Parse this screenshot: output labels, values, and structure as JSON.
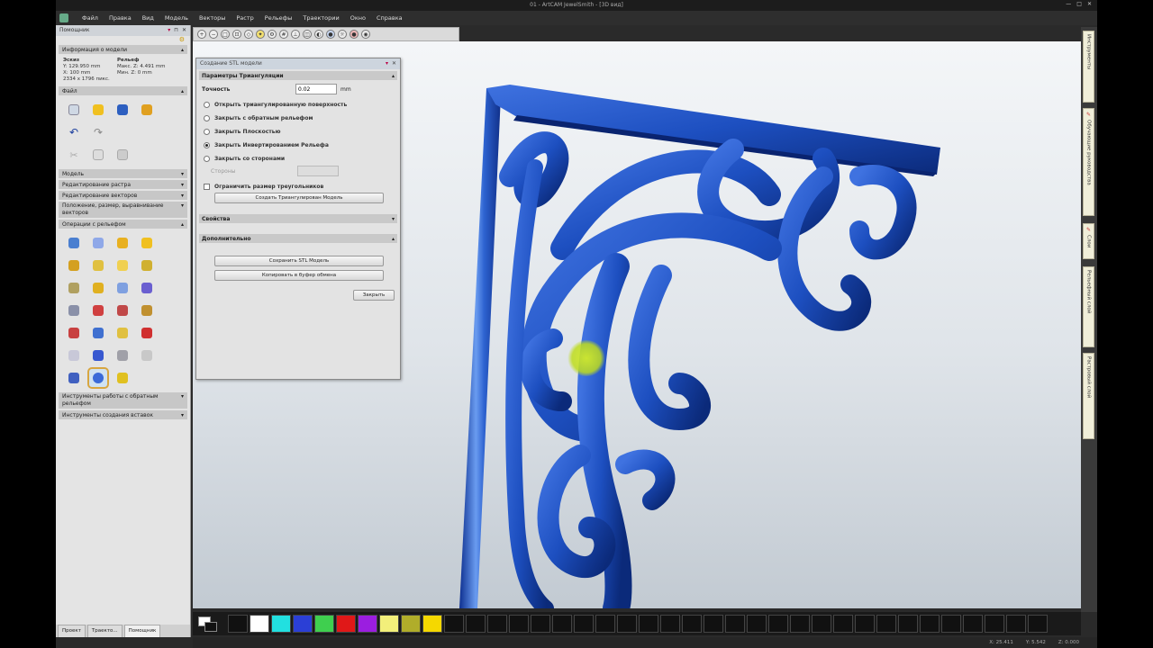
{
  "window": {
    "title": "01 - ArtCAM JewelSmith - [3D вид]"
  },
  "menu": {
    "items": [
      "Файл",
      "Правка",
      "Вид",
      "Модель",
      "Векторы",
      "Растр",
      "Рельефы",
      "Траектории",
      "Окно",
      "Справка"
    ]
  },
  "left_panel": {
    "title": "Помощник",
    "model_info": {
      "header": "Информация о модели",
      "col1_title": "Эскиз",
      "col2_title": "Рельеф",
      "line1_a": "Y: 129.950 mm",
      "line1_b": "Макс. Z: 4.491 mm",
      "line2_a": "X: 100 mm",
      "line2_b": "Мин. Z: 0 mm",
      "line3": "2334 x 1796 пикс."
    },
    "file_section": "Файл",
    "sections_a": [
      "Модель",
      "Редактирование растра",
      "Редактирование векторов"
    ],
    "section_position": "Положение, размер, выравнивание векторов",
    "section_ops": "Операции с рельефом",
    "section_tools": "Инструменты работы с обратным рельефом",
    "section_insert": "Инструменты создания вставок"
  },
  "bottom_tabs": [
    "Проект",
    "Траекто...",
    "Помощник"
  ],
  "dialog": {
    "title": "Создание STL модели",
    "section_triang": "Параметры Триангуляции",
    "accuracy_label": "Точность",
    "accuracy_value": "0.02",
    "accuracy_unit": "mm",
    "options": [
      "Открыть триангулированную поверхность",
      "Закрыть с обратным рельефом",
      "Закрыть Плоскостью",
      "Закрыть Инвертированием Рельефа",
      "Закрыть со сторонами"
    ],
    "sides_label": "Стороны",
    "sides_value": "",
    "limit_label": "Ограничить размер треугольников",
    "create_button": "Создать Триангулирован Модель",
    "section_props": "Свойства",
    "section_extra": "Дополнительно",
    "save_button": "Сохранить STL Модель",
    "copy_button": "Копировать в буфер обмена",
    "close_button": "Закрыть"
  },
  "right_tabs": [
    "Инструменты",
    "Обучающие руководства",
    "Слои",
    "Рельефный слой",
    "Растровый слой"
  ],
  "status": {
    "x": "X: 25.411",
    "y": "Y: 5.542",
    "z": "Z: 0.000"
  },
  "colors": {
    "accent": "#1f4fb5",
    "swatches": [
      "#111111",
      "#ffffff",
      "#22e0e0",
      "#2b3fd6",
      "#3fcf4f",
      "#e01818",
      "#9b1ee0",
      "#f2ef7a",
      "#b0ad2a",
      "#f5d800",
      "#111111",
      "#111111",
      "#111111",
      "#111111",
      "#111111",
      "#111111",
      "#111111",
      "#111111",
      "#111111",
      "#111111",
      "#111111",
      "#111111",
      "#111111",
      "#111111",
      "#111111",
      "#111111",
      "#111111",
      "#111111",
      "#111111",
      "#111111",
      "#111111",
      "#111111",
      "#111111",
      "#111111",
      "#111111",
      "#111111",
      "#111111",
      "#111111"
    ]
  }
}
